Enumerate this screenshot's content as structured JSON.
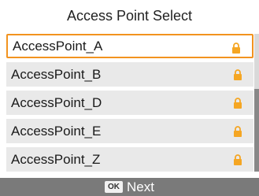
{
  "header": {
    "title": "Access Point Select"
  },
  "access_points": [
    {
      "name": "AccessPoint_A",
      "secured": true,
      "selected": true
    },
    {
      "name": "AccessPoint_B",
      "secured": true,
      "selected": false
    },
    {
      "name": "AccessPoint_D",
      "secured": true,
      "selected": false
    },
    {
      "name": "AccessPoint_E",
      "secured": true,
      "selected": false
    },
    {
      "name": "AccessPoint_Z",
      "secured": true,
      "selected": false
    }
  ],
  "icons": {
    "lock": "lock-icon"
  },
  "colors": {
    "accent": "#f2931f",
    "lock": "#f5a623",
    "footer": "#7a7a7a"
  },
  "footer": {
    "ok_key": "OK",
    "next_label": "Next"
  }
}
